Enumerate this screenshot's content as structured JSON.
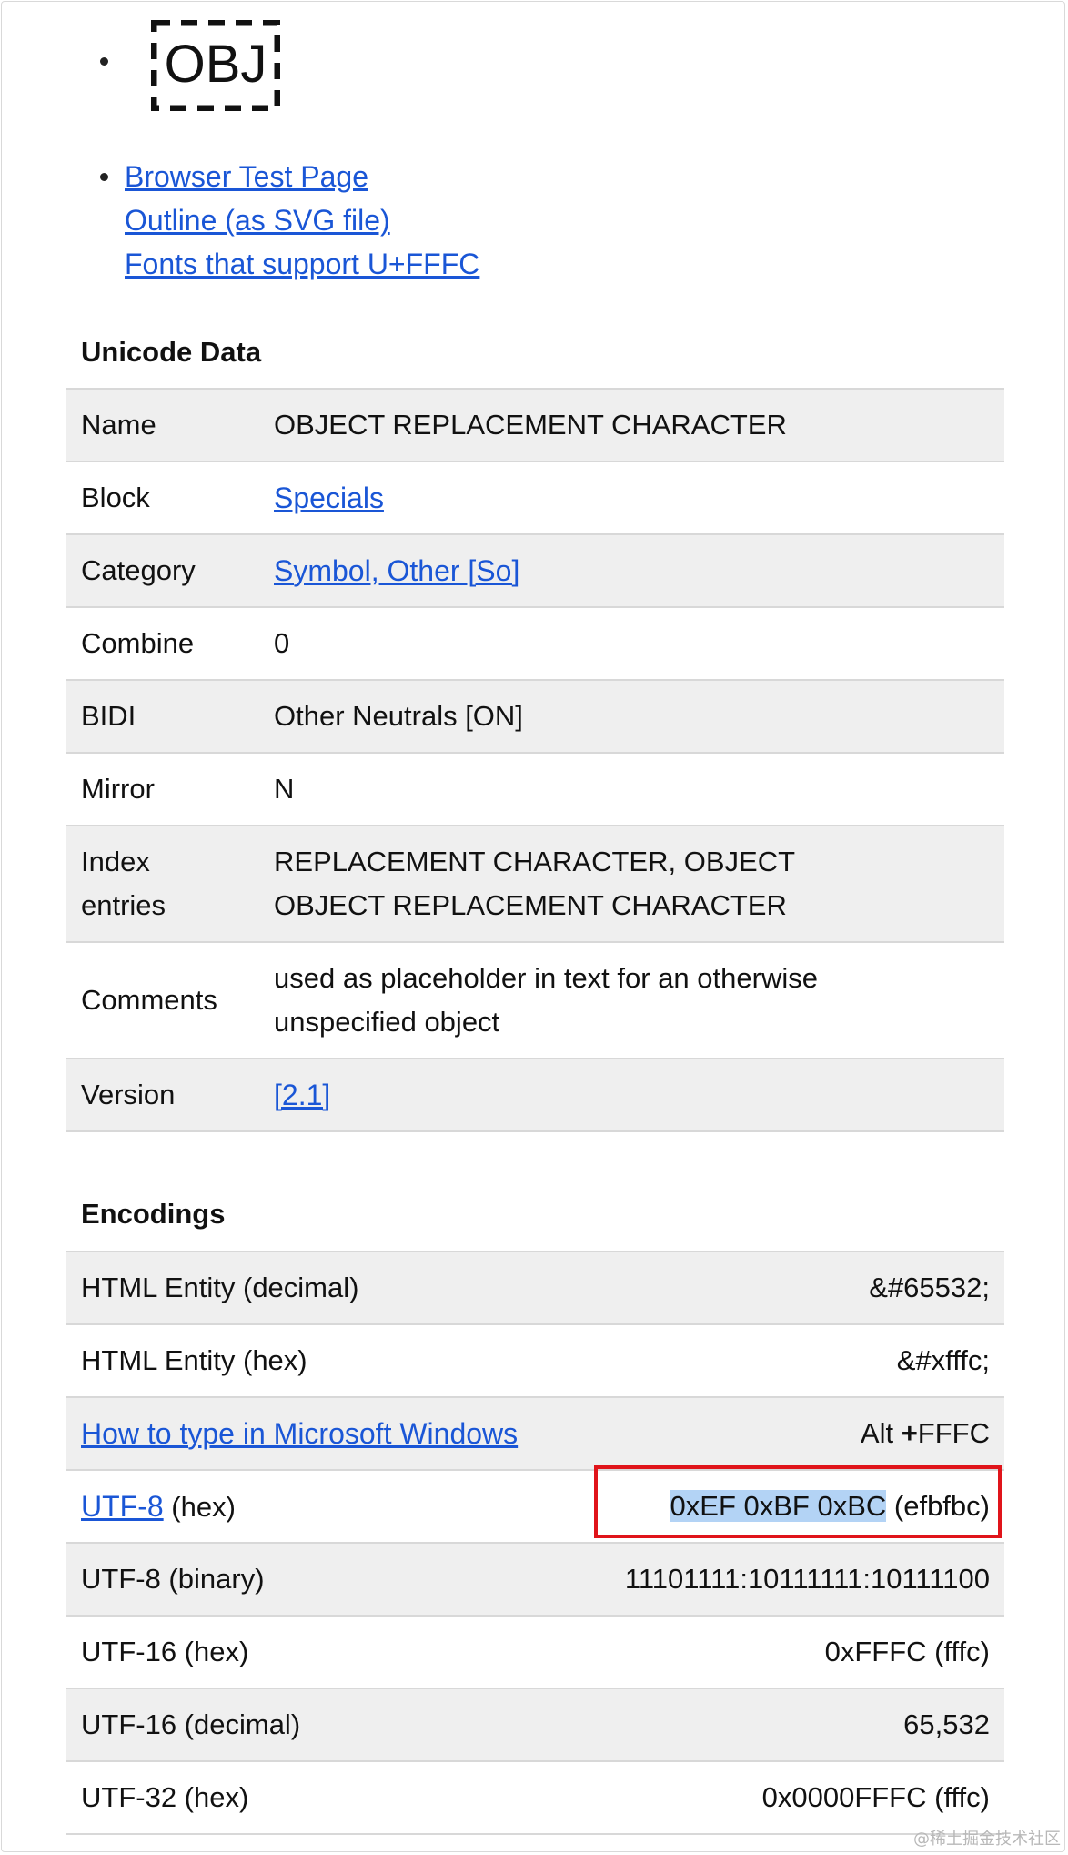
{
  "glyph_image": {
    "text": "OBJ"
  },
  "links": [
    {
      "label": "Browser Test Page"
    },
    {
      "label": "Outline (as SVG file)"
    },
    {
      "label": "Fonts that support U+FFFC"
    }
  ],
  "unicode_data": {
    "title": "Unicode Data",
    "rows": [
      {
        "key": "Name",
        "value": "OBJECT REPLACEMENT CHARACTER"
      },
      {
        "key": "Block",
        "value": "Specials"
      },
      {
        "key": "Category",
        "value": "Symbol, Other [So]"
      },
      {
        "key": "Combine",
        "value": "0"
      },
      {
        "key": "BIDI",
        "value": "Other Neutrals [ON]"
      },
      {
        "key": "Mirror",
        "value": "N"
      },
      {
        "key_line1": "Index",
        "key_line2": "entries",
        "value_line1": "REPLACEMENT CHARACTER, OBJECT",
        "value_line2": "OBJECT REPLACEMENT CHARACTER"
      },
      {
        "key": "Comments",
        "value_line1": "used as placeholder in text for an otherwise",
        "value_line2": "unspecified object"
      },
      {
        "key": "Version",
        "value": "[2.1]"
      }
    ]
  },
  "encodings": {
    "title": "Encodings",
    "rows": [
      {
        "key": "HTML Entity (decimal)",
        "value": "&#65532;"
      },
      {
        "key": "HTML Entity (hex)",
        "value": "&#xfffc;"
      },
      {
        "key": "How to type in Microsoft Windows",
        "value_prefix": "Alt ",
        "value_plus": "+",
        "value_rest": "FFFC"
      },
      {
        "key_link": "UTF-8",
        "key_suffix": " (hex)",
        "value_highlight": "0xEF 0xBF 0xBC",
        "value_rest": " (efbfbc)"
      },
      {
        "key": "UTF-8 (binary)",
        "value": "11101111:10111111:10111100"
      },
      {
        "key": "UTF-16 (hex)",
        "value": "0xFFFC (fffc)"
      },
      {
        "key": "UTF-16 (decimal)",
        "value": "65,532"
      },
      {
        "key": "UTF-32 (hex)",
        "value": "0x0000FFFC (fffc)"
      }
    ]
  },
  "watermark": "@稀土掘金技术社区",
  "colors": {
    "link": "#1a56d6",
    "row_shade": "#efefef",
    "highlight": "#b3d3f5",
    "annotation_box": "#e0141a"
  }
}
